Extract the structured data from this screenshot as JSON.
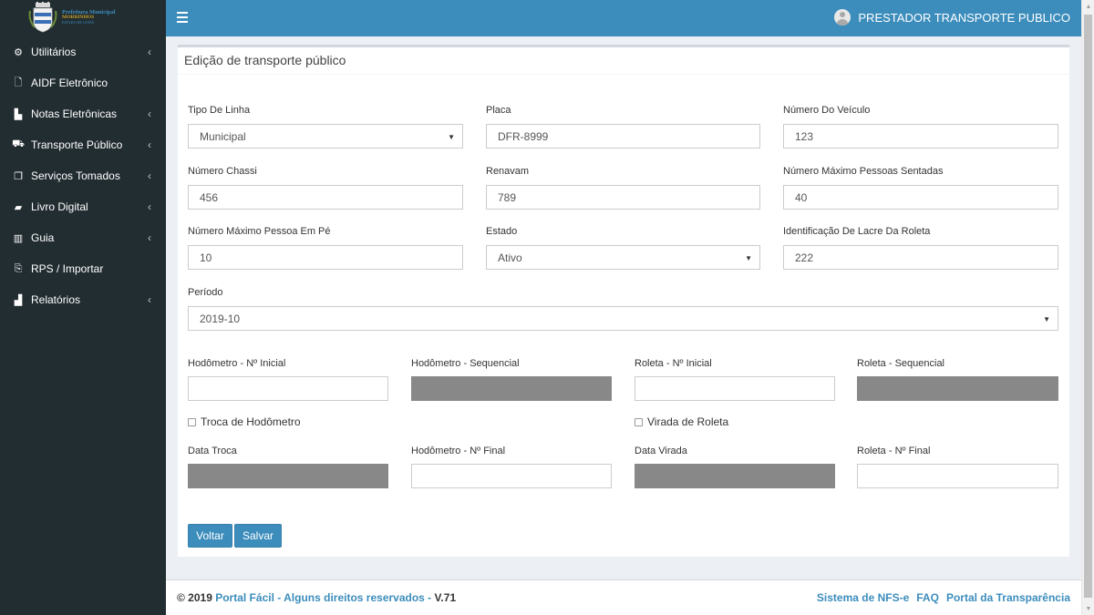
{
  "header": {
    "logo_lines": [
      "Prefeitura Municipal",
      "MORRINHOS",
      "ESTADO DE GOIÁS"
    ],
    "user_name": "PRESTADOR TRANSPORTE PUBLICO"
  },
  "sidebar": {
    "items": [
      {
        "label": "Utilitários",
        "icon": "gear-icon",
        "glyph": "⚙",
        "has_children": true
      },
      {
        "label": "AIDF Eletrônico",
        "icon": "file-icon",
        "glyph": "🗋",
        "has_children": false
      },
      {
        "label": "Notas Eletrônicas",
        "icon": "document-icon",
        "glyph": "▙",
        "has_children": true
      },
      {
        "label": "Transporte Público",
        "icon": "bus-icon",
        "glyph": "⛟",
        "has_children": true
      },
      {
        "label": "Serviços Tomados",
        "icon": "copy-icon",
        "glyph": "❐",
        "has_children": true
      },
      {
        "label": "Livro Digital",
        "icon": "book-icon",
        "glyph": "▰",
        "has_children": true
      },
      {
        "label": "Guia",
        "icon": "barcode-icon",
        "glyph": "▥",
        "has_children": true
      },
      {
        "label": "RPS / Importar",
        "icon": "file-export-icon",
        "glyph": "⎘",
        "has_children": false
      },
      {
        "label": "Relatórios",
        "icon": "bar-chart-icon",
        "glyph": "▟",
        "has_children": true
      }
    ],
    "chevron": "‹"
  },
  "form": {
    "title": "Edição de transporte público",
    "tipo_linha": {
      "label": "Tipo De Linha",
      "value": "Municipal"
    },
    "placa": {
      "label": "Placa",
      "value": "DFR-8999"
    },
    "numero_veiculo": {
      "label": "Número Do Veículo",
      "value": "123"
    },
    "numero_chassi": {
      "label": "Número Chassi",
      "value": "456"
    },
    "renavam": {
      "label": "Renavam",
      "value": "789"
    },
    "max_sentadas": {
      "label": "Número Máximo Pessoas Sentadas",
      "value": "40"
    },
    "max_em_pe": {
      "label": "Número Máximo Pessoa Em Pé",
      "value": "10"
    },
    "estado": {
      "label": "Estado",
      "value": "Ativo"
    },
    "lacre_roleta": {
      "label": "Identificação De Lacre Da Roleta",
      "value": "222"
    },
    "periodo": {
      "label": "Período",
      "value": "2019-10"
    },
    "hodometro_inicial": {
      "label": "Hodômetro - Nº Inicial",
      "value": ""
    },
    "hodometro_sequencial": {
      "label": "Hodômetro - Sequencial",
      "value": ""
    },
    "roleta_inicial": {
      "label": "Roleta - Nº Inicial",
      "value": ""
    },
    "roleta_sequencial": {
      "label": "Roleta - Sequencial",
      "value": ""
    },
    "troca_hodometro": {
      "label": "Troca de Hodômetro",
      "checked": false
    },
    "virada_roleta": {
      "label": "Virada de Roleta",
      "checked": false
    },
    "data_troca": {
      "label": "Data Troca",
      "value": ""
    },
    "hodometro_final": {
      "label": "Hodômetro - Nº Final",
      "value": ""
    },
    "data_virada": {
      "label": "Data Virada",
      "value": ""
    },
    "roleta_final": {
      "label": "Roleta - Nº Final",
      "value": ""
    },
    "btn_voltar": "Voltar",
    "btn_salvar": "Salvar"
  },
  "footer": {
    "copyright": "© 2019",
    "portal_link": "Portal Fácil",
    "rights": "- Alguns direitos reservados -",
    "version": "V.71",
    "links": [
      "Sistema de NFS-e",
      "FAQ",
      "Portal da Transparência"
    ]
  },
  "colors": {
    "primary": "#3c8dbc",
    "sidebar_bg": "#222d32",
    "page_bg": "#ecf0f5",
    "disabled_field": "#888888"
  }
}
